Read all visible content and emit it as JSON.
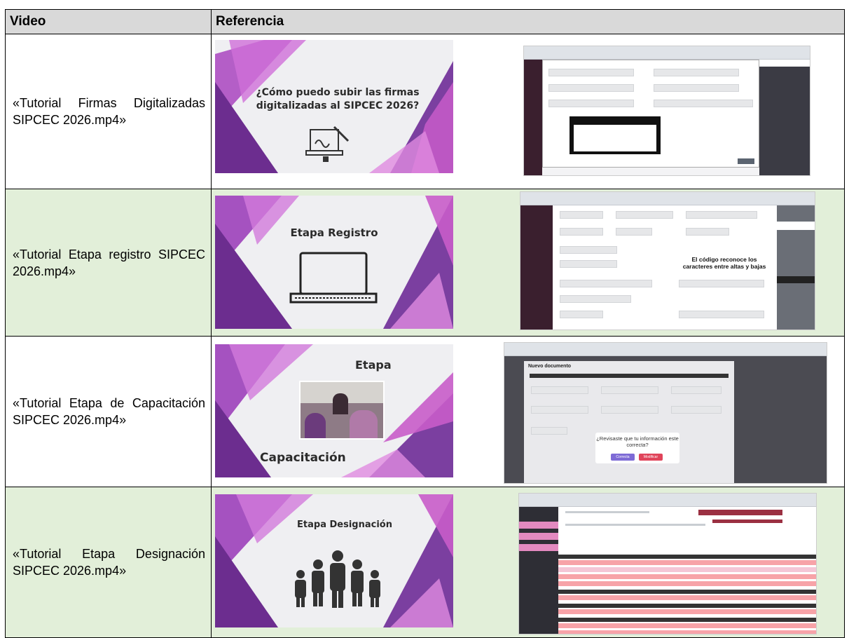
{
  "header": {
    "col_video": "Video",
    "col_ref": "Referencia"
  },
  "rows": [
    {
      "video": "«Tutorial Firmas Digitalizadas SIPCEC 2026.mp4»",
      "thumb_title": "¿Cómo puedo subir las firmas digitalizadas al SIPCEC 2026?"
    },
    {
      "video": "«Tutorial Etapa registro SIPCEC 2026.mp4»",
      "thumb_title": "Etapa Registro",
      "shot_text": "El código reconoce los caracteres entre altas y bajas"
    },
    {
      "video": "«Tutorial Etapa de Capacitación SIPCEC 2026.mp4»",
      "thumb_title_top": "Etapa",
      "thumb_title_bottom": "Capacitación",
      "shot_title": "Nuevo documento",
      "shot_text": "¿Revisaste que tu información este correcta?",
      "shot_btn1": "Correcta",
      "shot_btn2": "Modificar"
    },
    {
      "video": "«Tutorial Etapa Designación SIPCEC 2026.mp4»",
      "thumb_title": "Etapa Designación"
    }
  ],
  "colors": {
    "header_bg": "#d9d9d9",
    "green_row": "#e2efd9",
    "purple": "#7b3fa0",
    "magenta": "#c23ba8"
  }
}
